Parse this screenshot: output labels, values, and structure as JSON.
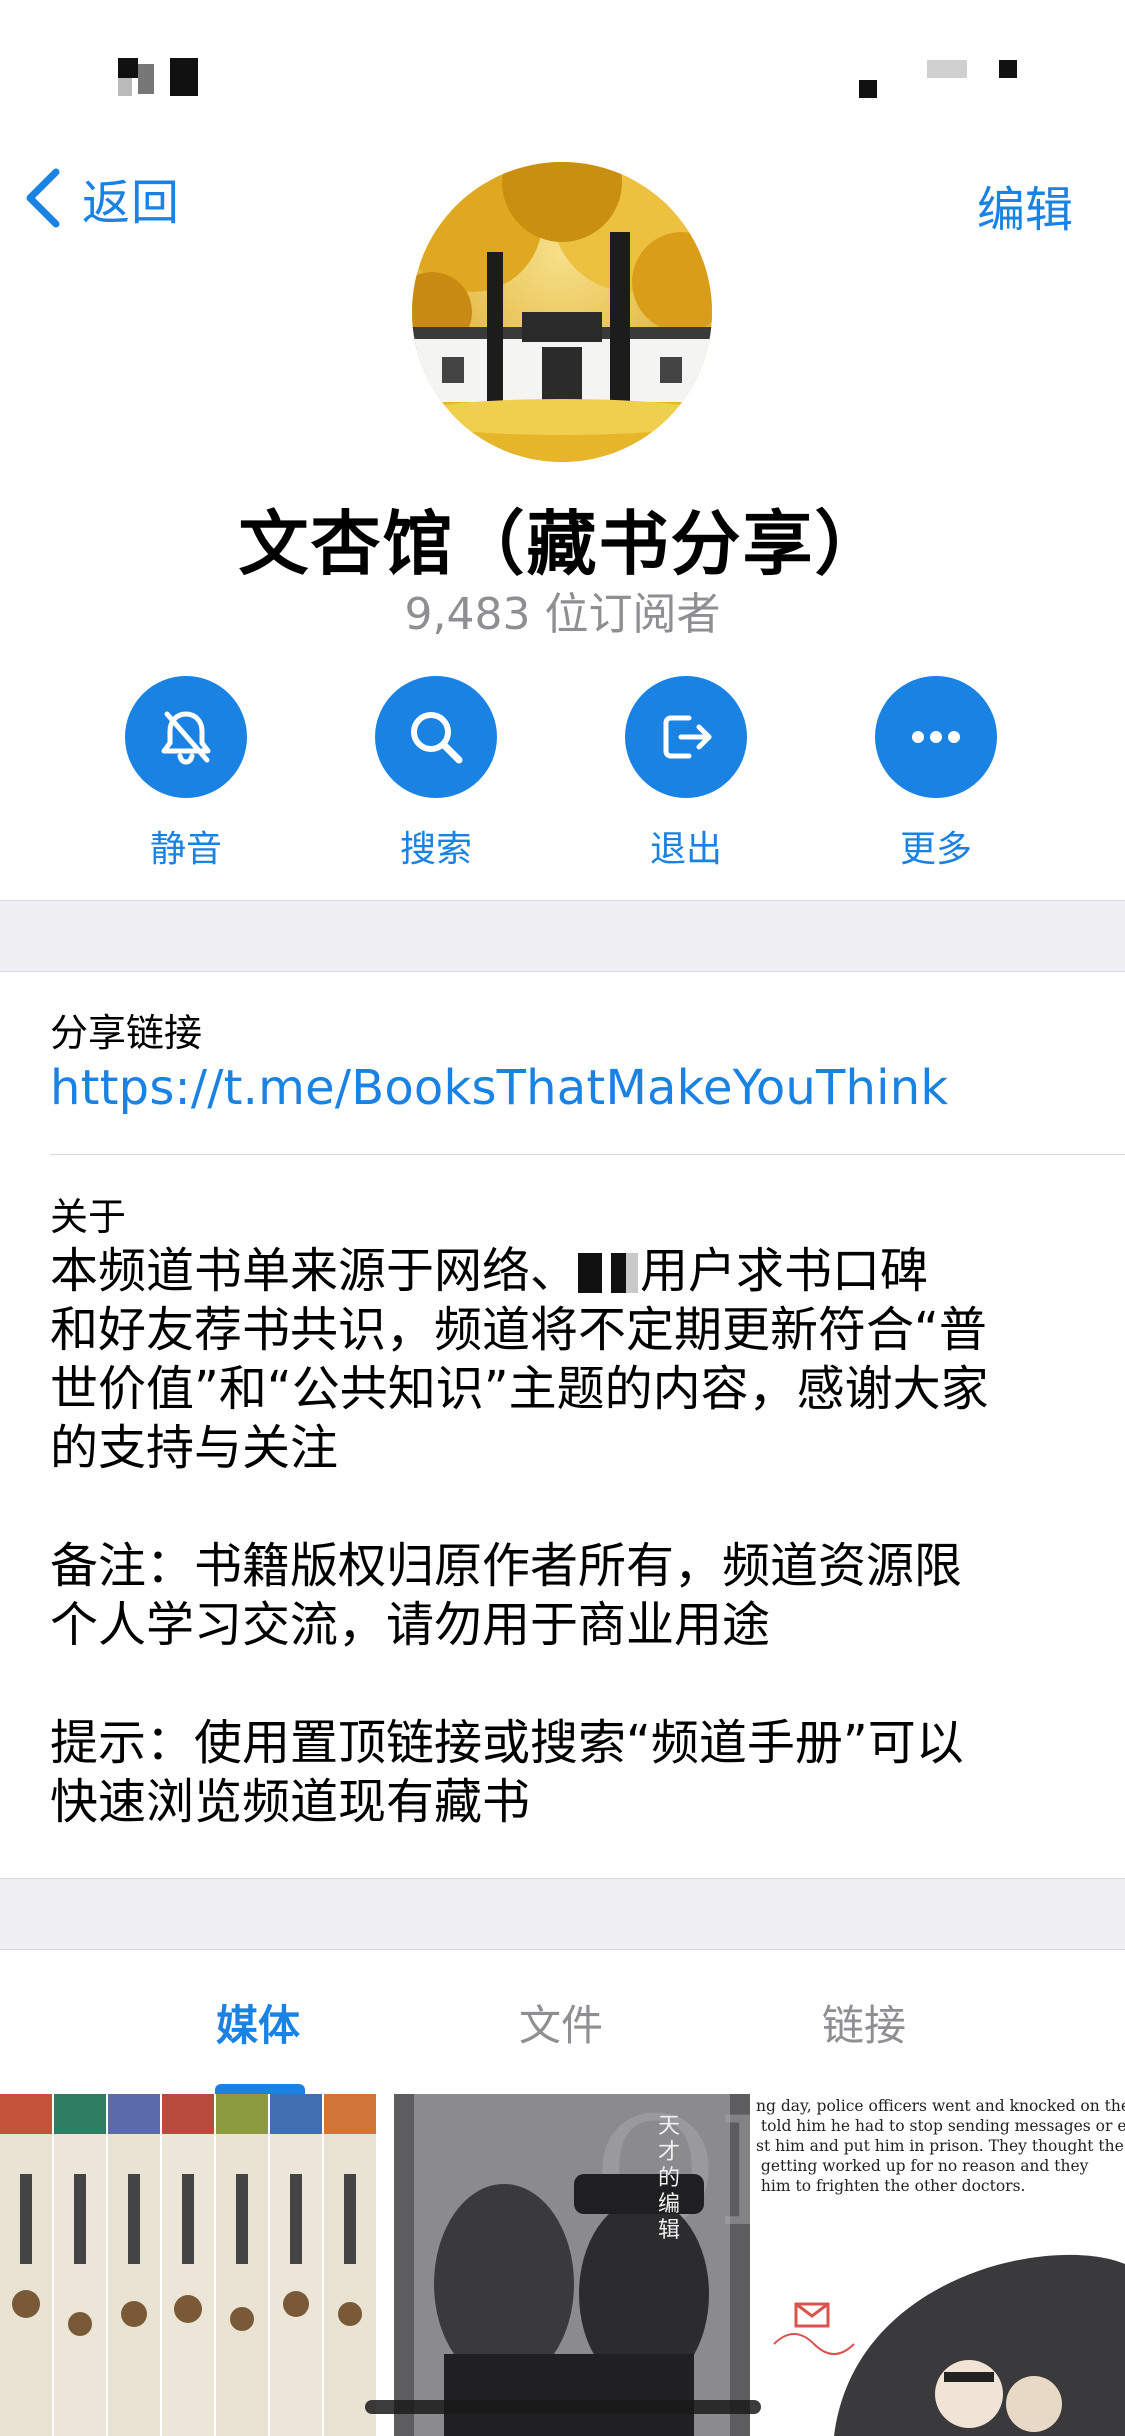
{
  "nav": {
    "back_label": "返回",
    "edit_label": "编辑"
  },
  "channel": {
    "title": "文杏馆（藏书分享）",
    "subscribers": "9,483 位订阅者"
  },
  "actions": [
    {
      "label": "静音",
      "icon": "bell-slash-icon"
    },
    {
      "label": "搜索",
      "icon": "search-icon"
    },
    {
      "label": "退出",
      "icon": "leave-icon"
    },
    {
      "label": "更多",
      "icon": "more-icon"
    }
  ],
  "info": {
    "share_link_label": "分享链接",
    "share_link": "https://t.me/BooksThatMakeYouThink",
    "about_label": "关于",
    "about_line1_before": "本频道书单来源于网络、",
    "about_line1_after": "用户求书口碑",
    "about_rest": "和好友荐书共识，频道将不定期更新符合“普\n世价值”和“公共知识”主题的内容，感谢大家\n的支持与关注\n\n备注：书籍版权归原作者所有，频道资源限\n个人学习交流，请勿用于商业用途\n\n提示：使用置顶链接或搜索“频道手册”可以\n快速浏览频道现有藏书"
  },
  "tabs": [
    {
      "label": "媒体",
      "active": true
    },
    {
      "label": "文件",
      "active": false
    },
    {
      "label": "链接",
      "active": false
    }
  ],
  "media": {
    "book2_title": "天才的编辑",
    "comic_text": "ng day, police officers went and knocked on the doct\n told him he had to stop sending messages or else the\nst him and put him in prison. They thought the\n getting worked up for no reason and they\n him to frighten the other doctors."
  },
  "colors": {
    "accent": "#1a82e2",
    "secondary_text": "#8e8e93",
    "band": "#efeff4"
  }
}
